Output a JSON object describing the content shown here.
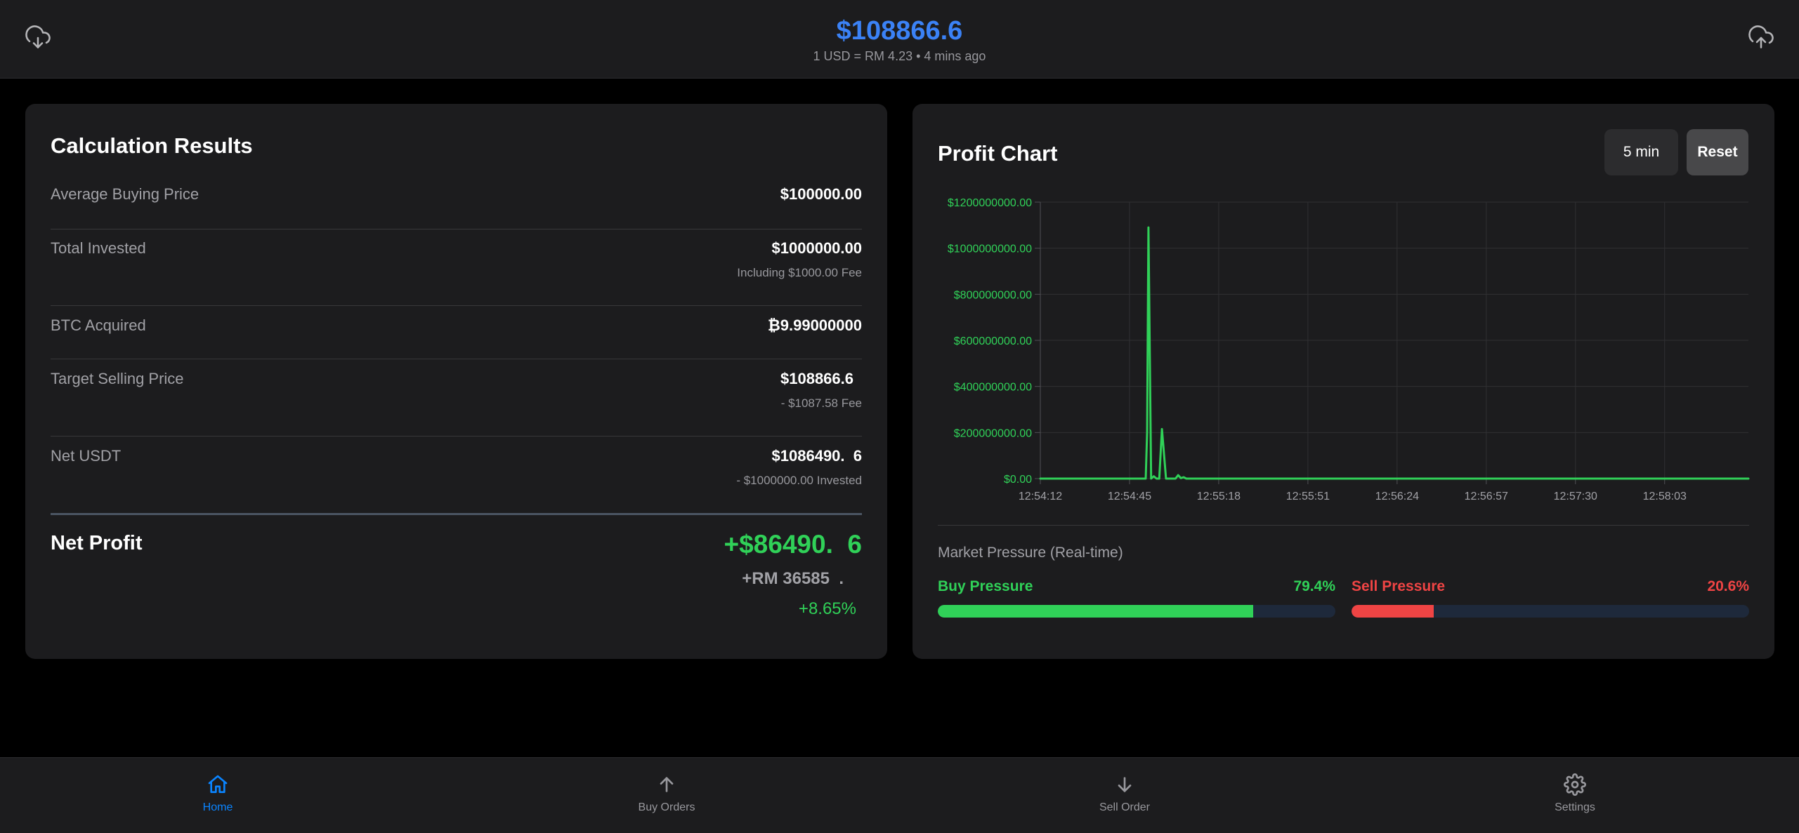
{
  "header": {
    "price": "$108866.6",
    "subtitle": "1 USD = RM 4.23 • 4 mins ago",
    "left_icon": "cloud-download-icon",
    "right_icon": "cloud-upload-icon"
  },
  "calc": {
    "title": "Calculation Results",
    "rows": [
      {
        "label": "Average Buying Price",
        "value": "$100000.00",
        "note": ""
      },
      {
        "label": "Total Invested",
        "value": "$1000000.00",
        "note": "Including $1000.00 Fee"
      },
      {
        "label": "BTC Acquired",
        "value": "₿9.99000000",
        "note": ""
      },
      {
        "label": "Target Selling Price",
        "value": "$108866.6",
        "note": "- $1087.58 Fee"
      },
      {
        "label": "Net USDT",
        "value": "$1086490.  6",
        "note": "- $1000000.00 Invested"
      }
    ],
    "net_profit": {
      "label": "Net Profit",
      "value": "+$86490.  6",
      "rm": "+RM 36585  .",
      "percent": "+8.65%"
    }
  },
  "chart_card": {
    "title": "Profit Chart",
    "interval_label": "5 min",
    "reset_label": "Reset"
  },
  "chart_data": {
    "type": "line",
    "title": "Profit Chart",
    "xlabel": "",
    "ylabel": "",
    "ylim": [
      0,
      1200000000
    ],
    "y_ticks": [
      "$1200000000.00",
      "$1000000000.00",
      "$800000000.00",
      "$600000000.00",
      "$400000000.00",
      "$200000000.00",
      "$0.00"
    ],
    "x_ticks": [
      "12:54:12",
      "12:54:45",
      "12:55:18",
      "12:55:51",
      "12:56:24",
      "12:56:57",
      "12:57:30",
      "12:58:03"
    ],
    "grid": true,
    "line_color": "#30d158",
    "series": [
      {
        "points": [
          {
            "t": "12:54:12",
            "v": 0
          },
          {
            "t": "12:54:51",
            "v": 0
          },
          {
            "t": "12:54:51.5",
            "v": 200000000
          },
          {
            "t": "12:54:52",
            "v": 1090000000
          },
          {
            "t": "12:54:53",
            "v": 0
          },
          {
            "t": "12:54:54",
            "v": 10000000
          },
          {
            "t": "12:54:55",
            "v": 0
          },
          {
            "t": "12:54:56",
            "v": 0
          },
          {
            "t": "12:54:57",
            "v": 215000000
          },
          {
            "t": "12:54:58.5",
            "v": 0
          },
          {
            "t": "12:55:02",
            "v": 0
          },
          {
            "t": "12:55:03",
            "v": 15000000
          },
          {
            "t": "12:55:04",
            "v": 2000000
          },
          {
            "t": "12:55:05",
            "v": 6000000
          },
          {
            "t": "12:55:06",
            "v": 0
          },
          {
            "t": "12:58:34",
            "v": 0
          }
        ]
      }
    ]
  },
  "pressure": {
    "title": "Market Pressure (Real-time)",
    "buy_label": "Buy Pressure",
    "buy_pct_text": "79.4%",
    "buy_fraction": 0.794,
    "sell_label": "Sell Pressure",
    "sell_pct_text": "20.6%",
    "sell_fraction": 0.206,
    "buy_color": "#30d158",
    "sell_color": "#ef4444"
  },
  "nav": {
    "items": [
      {
        "label": "Home",
        "icon": "home-icon",
        "active": true
      },
      {
        "label": "Buy Orders",
        "icon": "arrow-up-icon",
        "active": false
      },
      {
        "label": "Sell Order",
        "icon": "arrow-down-icon",
        "active": false
      },
      {
        "label": "Settings",
        "icon": "gear-icon",
        "active": false
      }
    ],
    "active_color": "#0a84ff",
    "inactive_color": "#98989d"
  }
}
